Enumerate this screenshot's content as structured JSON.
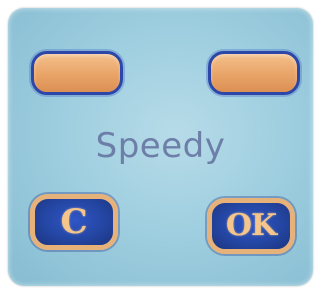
{
  "panel": {
    "brand_text": "Speedy",
    "keys": {
      "top_left": {
        "label": ""
      },
      "top_right": {
        "label": ""
      },
      "bottom_left": {
        "label": "C"
      },
      "bottom_right": {
        "label": "OK"
      }
    }
  },
  "colors": {
    "panel_blue": "#9fcfe0",
    "key_orange": "#e9a468",
    "key_blue": "#23449f",
    "outline_blue": "#2c47a7",
    "label_gold": "#f5c58a",
    "brand_text": "#6d7fa9"
  }
}
